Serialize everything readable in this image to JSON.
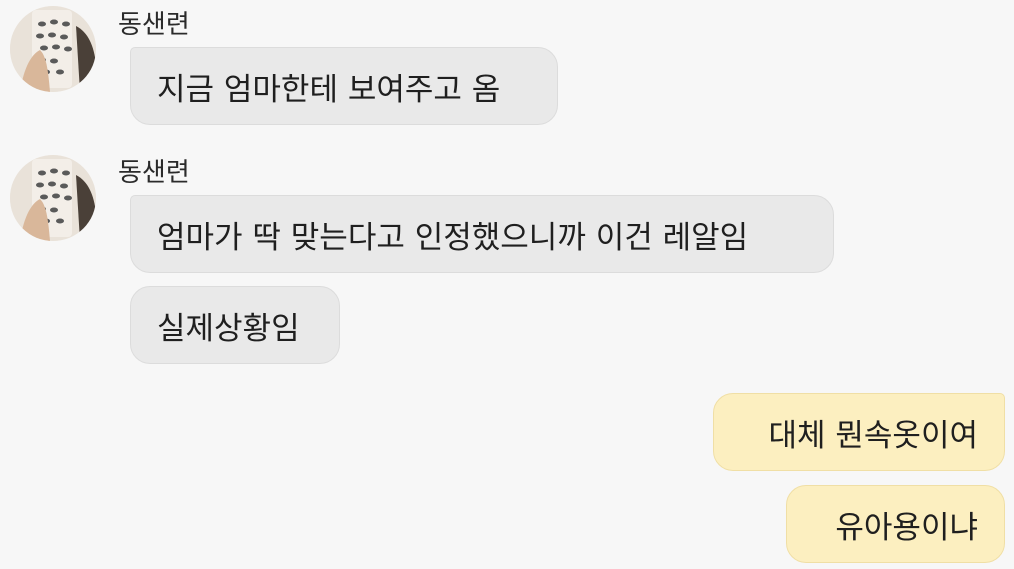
{
  "chat": {
    "groups": [
      {
        "sender": "동샌련",
        "messages": [
          "지금 엄마한테 보여주고 옴"
        ]
      },
      {
        "sender": "동샌련",
        "messages": [
          "엄마가 딱 맞는다고 인정했으니까 이건 레알임",
          "실제상황임"
        ]
      }
    ],
    "outgoing": [
      "대체 뭔속옷이여",
      "유아용이냐"
    ]
  },
  "colors": {
    "background": "#f7f7f7",
    "incoming_bubble": "#e9e9e9",
    "outgoing_bubble": "#fcefc0"
  }
}
